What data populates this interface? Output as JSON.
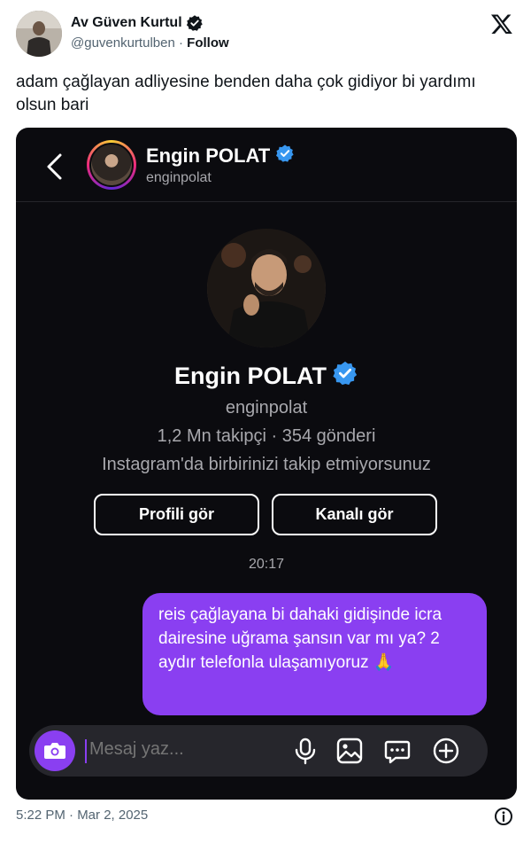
{
  "tweet": {
    "author_name": "Av Güven Kurtul",
    "author_handle": "@guvenkurtulben",
    "separator": "·",
    "follow_label": "Follow",
    "text": "adam çağlayan adliyesine benden daha çok gidiyor bi yardımı olsun bari",
    "timestamp": "5:22 PM · Mar 2, 2025"
  },
  "instagram": {
    "top_name": "Engin POLAT",
    "top_handle": "enginpolat",
    "profile_name": "Engin POLAT",
    "profile_handle": "enginpolat",
    "stats": "1,2 Mn takipçi · 354 gönderi",
    "follow_status": "Instagram'da birbirinizi takip etmiyorsunuz",
    "view_profile_label": "Profili gör",
    "view_channel_label": "Kanalı gör",
    "message_time": "20:17",
    "message_text": "reis çağlayana bi dahaki gidişinde icra dairesine uğrama şansın var mı ya? 2 aydır telefonla ulaşamıyoruz 🙏",
    "composer_placeholder": "Mesaj yaz..."
  },
  "icons": {
    "verified": "verified-badge-icon",
    "x_logo": "x-logo-icon",
    "back": "chevron-left-icon",
    "camera": "camera-icon",
    "mic": "microphone-icon",
    "gallery": "image-icon",
    "sticker": "sticker-icon",
    "plus": "plus-circle-icon",
    "info": "info-icon"
  },
  "colors": {
    "ig_accent": "#8a3ff1",
    "verified_blue": "#3897f0",
    "ig_background": "#0b0b0f"
  }
}
